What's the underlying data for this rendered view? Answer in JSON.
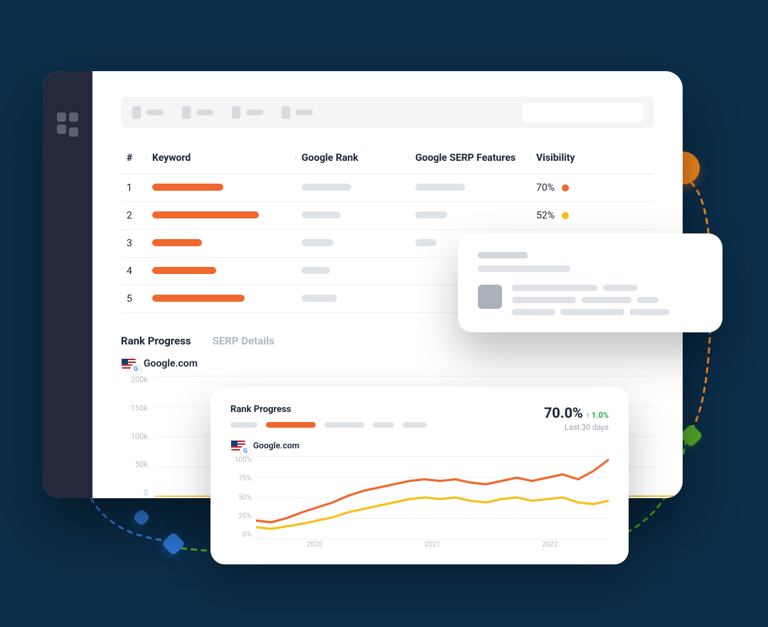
{
  "table": {
    "headers": {
      "idx": "#",
      "keyword": "Keyword",
      "rank": "Google Rank",
      "features": "Google SERP Features",
      "visibility": "Visibility"
    },
    "rows": [
      {
        "idx": "1",
        "visibility": "70%",
        "dot": "orange",
        "kw_len": 100,
        "rank_len": 70,
        "feat_len": 70
      },
      {
        "idx": "2",
        "visibility": "52%",
        "dot": "yellow",
        "kw_len": 150,
        "rank_len": 55,
        "feat_len": 45
      },
      {
        "idx": "3",
        "visibility": "",
        "dot": "",
        "kw_len": 70,
        "rank_len": 45,
        "feat_len": 30
      },
      {
        "idx": "4",
        "visibility": "",
        "dot": "",
        "kw_len": 90,
        "rank_len": 40,
        "feat_len": 0
      },
      {
        "idx": "5",
        "visibility": "",
        "dot": "",
        "kw_len": 130,
        "rank_len": 50,
        "feat_len": 0
      }
    ]
  },
  "tabs": {
    "rank": "Rank Progress",
    "serp": "SERP Details"
  },
  "source": "Google.com",
  "chart_data": [
    {
      "id": "big",
      "type": "line",
      "title": "Rank Progress",
      "ylabel": "",
      "ylim": [
        0,
        200000
      ],
      "yticks": [
        "200k",
        "150k",
        "100k",
        "50k",
        "0"
      ],
      "x": [
        0,
        1,
        2,
        3,
        4,
        5,
        6,
        7,
        8,
        9,
        10,
        11,
        12,
        13,
        14,
        15,
        16,
        17,
        18,
        19
      ],
      "series": [
        {
          "name": "primary",
          "color": "#f0682e",
          "values": [
            32,
            30,
            38,
            44,
            42,
            50,
            58,
            62,
            70,
            78,
            86,
            90,
            96,
            104,
            112,
            120,
            132,
            148,
            170,
            200
          ]
        },
        {
          "name": "secondary",
          "color": "#f3c11a",
          "values": [
            22,
            20,
            26,
            30,
            28,
            34,
            40,
            44,
            50,
            56,
            62,
            66,
            72,
            78,
            86,
            92,
            102,
            116,
            136,
            162
          ]
        }
      ]
    },
    {
      "id": "small",
      "type": "line",
      "title": "Rank Progress",
      "ylabel": "",
      "ylim": [
        0,
        100
      ],
      "yticks": [
        "100%",
        "75%",
        "50%",
        "25%",
        "0%"
      ],
      "xticks": [
        "2020",
        "2021",
        "2022"
      ],
      "x": [
        0,
        1,
        2,
        3,
        4,
        5,
        6,
        7,
        8,
        9,
        10,
        11,
        12,
        13,
        14,
        15,
        16,
        17,
        18,
        19,
        20,
        21,
        22,
        23
      ],
      "series": [
        {
          "name": "primary",
          "color": "#f0682e",
          "values": [
            22,
            20,
            25,
            32,
            38,
            44,
            52,
            58,
            62,
            66,
            70,
            72,
            70,
            72,
            68,
            66,
            70,
            74,
            70,
            74,
            78,
            72,
            82,
            96
          ]
        },
        {
          "name": "secondary",
          "color": "#f3c11a",
          "values": [
            14,
            12,
            15,
            18,
            22,
            26,
            32,
            36,
            40,
            44,
            48,
            50,
            48,
            50,
            46,
            44,
            48,
            50,
            46,
            48,
            50,
            44,
            42,
            46
          ]
        }
      ]
    }
  ],
  "rank_card": {
    "title": "Rank Progress",
    "pct": "70.0%",
    "delta": "↑ 1.0%",
    "subtitle": "Last 30 days"
  }
}
